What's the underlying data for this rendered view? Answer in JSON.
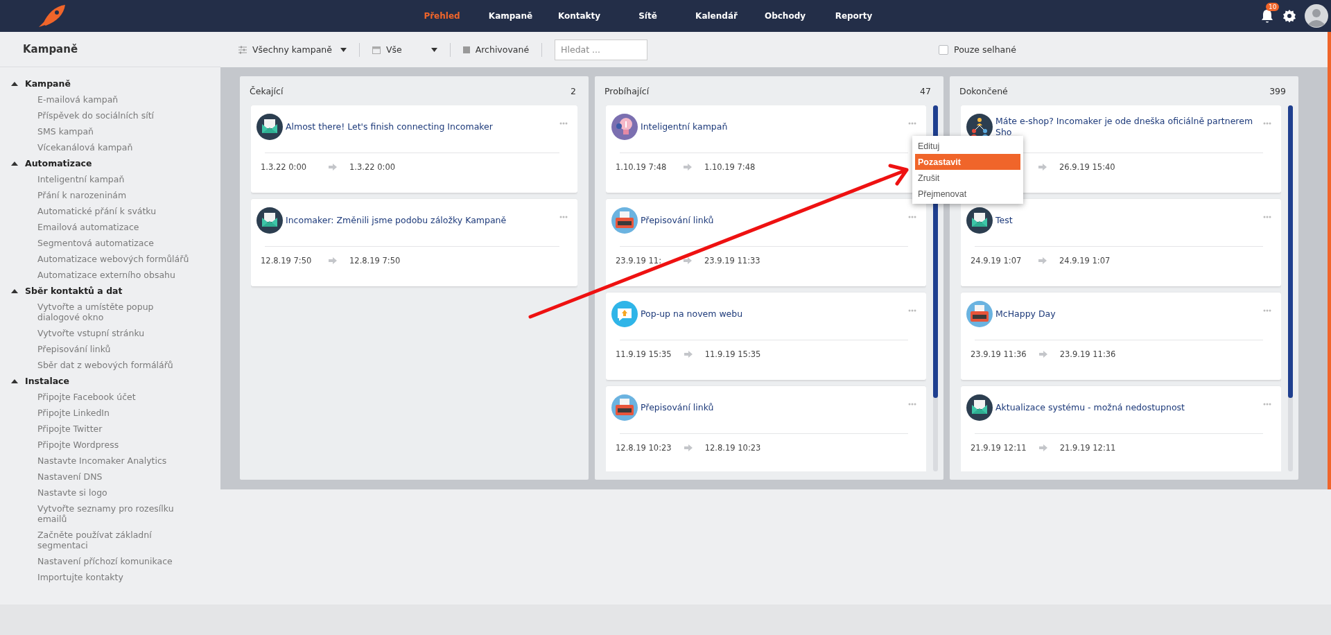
{
  "navigation": {
    "items": [
      {
        "label": "Přehled",
        "selected": true
      },
      {
        "label": "Kampaně",
        "selected": false
      },
      {
        "label": "Kontakty",
        "selected": false
      },
      {
        "label": "Sítě",
        "selected": false
      },
      {
        "label": "Kalendář",
        "selected": false
      },
      {
        "label": "Obchody",
        "selected": false
      },
      {
        "label": "Reporty",
        "selected": false
      }
    ],
    "notifications": "10"
  },
  "page_title": "Kampaně",
  "filters": {
    "campaign_select": "Všechny kampaně",
    "period_select": "Vše",
    "archived": "Archivované",
    "search": {
      "placeholder": "Hledat ..."
    },
    "failed_only": {
      "label": "Pouze selhané",
      "checked": false
    }
  },
  "sidebar": [
    {
      "label": "Kampaně",
      "expanded": true,
      "children": [
        {
          "label": "E-mailová kampaň"
        },
        {
          "label": "Příspěvek do sociálních sítí"
        },
        {
          "label": "SMS kampaň"
        },
        {
          "label": "Vícekanálová kampaň"
        }
      ]
    },
    {
      "label": "Automatizace",
      "expanded": true,
      "children": [
        {
          "label": "Inteligentní kampaň"
        },
        {
          "label": "Přání k narozeninám"
        },
        {
          "label": "Automatické přání k svátku"
        },
        {
          "label": "Emailová automatizace"
        },
        {
          "label": "Segmentová automatizace"
        },
        {
          "label": "Automatizace webových formůlářů"
        },
        {
          "label": "Automatizace externího obsahu"
        }
      ]
    },
    {
      "label": "Sběr kontaktů a dat",
      "expanded": true,
      "children": [
        {
          "label": "Vytvořte a umístěte popup dialogové okno"
        },
        {
          "label": "Vytvořte vstupní stránku"
        },
        {
          "label": "Přepisování linků"
        },
        {
          "label": "Sběr dat z webových formálářů"
        }
      ]
    },
    {
      "label": "Instalace",
      "expanded": true,
      "children": [
        {
          "label": "Připojte Facebook účet"
        },
        {
          "label": "Připojte LinkedIn"
        },
        {
          "label": "Připojte Twitter"
        },
        {
          "label": "Připojte Wordpress"
        },
        {
          "label": "Nastavte Incomaker Analytics"
        },
        {
          "label": "Nastavení DNS"
        },
        {
          "label": "Nastavte si logo"
        },
        {
          "label": "Vytvořte seznamy pro rozesílku emailů"
        },
        {
          "label": "Začněte používat základní segmentaci"
        },
        {
          "label": "Nastavení příchozí komunikace"
        },
        {
          "label": "Importujte kontakty"
        }
      ]
    }
  ],
  "columns": [
    {
      "title": "Čekající",
      "count": "2",
      "scrollbar": false,
      "cards": [
        {
          "kind": "envelope",
          "title": "Almost there! Let's finish connecting Incomaker",
          "start": "1.3.22 0:00",
          "end": "1.3.22 0:00"
        },
        {
          "kind": "envelope",
          "title": "Incomaker: Změnili jsme podobu záložky Kampaně",
          "start": "12.8.19 7:50",
          "end": "12.8.19 7:50"
        }
      ]
    },
    {
      "title": "Probíhající",
      "count": "47",
      "scrollbar": true,
      "cards": [
        {
          "kind": "bulb",
          "title": "Inteligentní kampaň",
          "start": "1.10.19 7:48",
          "end": "1.10.19 7:48"
        },
        {
          "kind": "typewriter",
          "title": "Přepisování linků",
          "start": "23.9.19 11:",
          "end": "23.9.19 11:33"
        },
        {
          "kind": "popup",
          "title": "Pop-up na novem webu",
          "start": "11.9.19 15:35",
          "end": "11.9.19 15:35"
        },
        {
          "kind": "typewriter",
          "title": "Přepisování linků",
          "start": "12.8.19 10:23",
          "end": "12.8.19 10:23"
        }
      ]
    },
    {
      "title": "Dokončené",
      "count": "399",
      "scrollbar": true,
      "cards": [
        {
          "kind": "network",
          "title": "Máte e-shop? Incomaker je ode dneška oficiálně partnerem Sho",
          "end": "26.9.19 15:40"
        },
        {
          "kind": "envelope",
          "title": "Test",
          "start": "24.9.19 1:07",
          "end": "24.9.19 1:07"
        },
        {
          "kind": "typewriter",
          "title": "McHappy Day",
          "start": "23.9.19 11:36",
          "end": "23.9.19 11:36"
        },
        {
          "kind": "envelope",
          "title": "Aktualizace systému - možná nedostupnost",
          "start": "21.9.19 12:11",
          "end": "21.9.19 12:11"
        }
      ]
    }
  ],
  "context_menu": {
    "items": [
      {
        "label": "Edituj",
        "selected": false
      },
      {
        "label": "Pozastavit",
        "selected": true
      },
      {
        "label": "Zrušit",
        "selected": false
      },
      {
        "label": "Přejmenovat",
        "selected": false
      }
    ]
  }
}
